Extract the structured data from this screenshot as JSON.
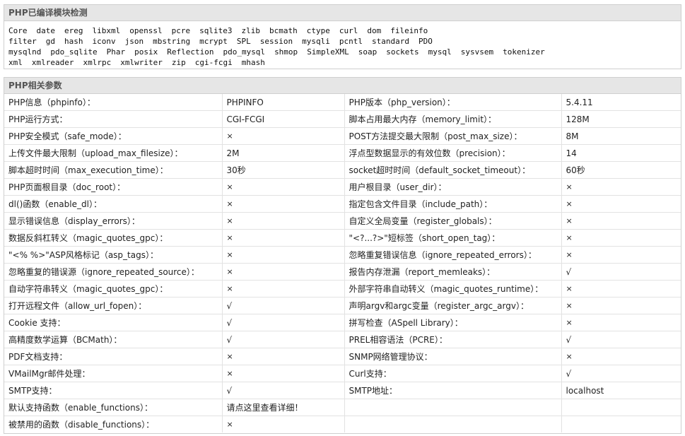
{
  "modules_panel": {
    "title": "PHP已编译模块检测",
    "lines": [
      [
        "Core",
        "date",
        "ereg",
        "libxml",
        "openssl",
        "pcre",
        "sqlite3",
        "zlib",
        "bcmath",
        "ctype",
        "curl",
        "dom",
        "fileinfo"
      ],
      [
        "filter",
        "gd",
        "hash",
        "iconv",
        "json",
        "mbstring",
        "mcrypt",
        "SPL",
        "session",
        "mysqli",
        "pcntl",
        "standard",
        "PDO"
      ],
      [
        "mysqlnd",
        "pdo_sqlite",
        "Phar",
        "posix",
        "Reflection",
        "pdo_mysql",
        "shmop",
        "SimpleXML",
        "soap",
        "sockets",
        "mysql",
        "sysvsem",
        "tokenizer"
      ],
      [
        "xml",
        "xmlreader",
        "xmlrpc",
        "xmlwriter",
        "zip",
        "cgi-fcgi",
        "mhash"
      ]
    ]
  },
  "params_panel": {
    "title": "PHP相关参数",
    "rows": [
      {
        "l1": "PHP信息（phpinfo）：",
        "v1": "PHPINFO",
        "t1": "gray",
        "l2": "PHP版本（php_version）：",
        "v2": "5.4.11",
        "t2": "text"
      },
      {
        "l1": "PHP运行方式：",
        "v1": "CGI-FCGI",
        "t1": "text",
        "l2": "脚本占用最大内存（memory_limit）：",
        "v2": "128M",
        "t2": "text"
      },
      {
        "l1": "PHP安全模式（safe_mode）：",
        "v1": "×",
        "t1": "no",
        "l2": "POST方法提交最大限制（post_max_size）：",
        "v2": "8M",
        "t2": "text"
      },
      {
        "l1": "上传文件最大限制（upload_max_filesize）：",
        "v1": "2M",
        "t1": "text",
        "l2": "浮点型数据显示的有效位数（precision）：",
        "v2": "14",
        "t2": "text"
      },
      {
        "l1": "脚本超时时间（max_execution_time）：",
        "v1": "30秒",
        "t1": "text",
        "l2": "socket超时时间（default_socket_timeout）：",
        "v2": "60秒",
        "t2": "text"
      },
      {
        "l1": "PHP页面根目录（doc_root）：",
        "v1": "×",
        "t1": "no",
        "l2": "用户根目录（user_dir）：",
        "v2": "×",
        "t2": "no"
      },
      {
        "l1": "dl()函数（enable_dl）：",
        "v1": "×",
        "t1": "no",
        "l2": "指定包含文件目录（include_path）：",
        "v2": "×",
        "t2": "no"
      },
      {
        "l1": "显示错误信息（display_errors）：",
        "v1": "×",
        "t1": "no",
        "l2": "自定义全局变量（register_globals）：",
        "v2": "×",
        "t2": "no"
      },
      {
        "l1": "数据反斜杠转义（magic_quotes_gpc）：",
        "v1": "×",
        "t1": "no",
        "l2": "\"<?...?>\"短标签（short_open_tag）：",
        "v2": "×",
        "t2": "no"
      },
      {
        "l1": "\"<% %>\"ASP风格标记（asp_tags）：",
        "v1": "×",
        "t1": "no",
        "l2": "忽略重复错误信息（ignore_repeated_errors）：",
        "v2": "×",
        "t2": "no"
      },
      {
        "l1": "忽略重复的错误源（ignore_repeated_source）：",
        "v1": "×",
        "t1": "no",
        "l2": "报告内存泄漏（report_memleaks）：",
        "v2": "√",
        "t2": "yes"
      },
      {
        "l1": "自动字符串转义（magic_quotes_gpc）：",
        "v1": "×",
        "t1": "no",
        "l2": "外部字符串自动转义（magic_quotes_runtime）：",
        "v2": "×",
        "t2": "no"
      },
      {
        "l1": "打开远程文件（allow_url_fopen）：",
        "v1": "√",
        "t1": "yes",
        "l2": "声明argv和argc变量（register_argc_argv）：",
        "v2": "×",
        "t2": "no"
      },
      {
        "l1": "Cookie 支持：",
        "v1": "√",
        "t1": "yes",
        "l2": "拼写检查（ASpell Library）：",
        "v2": "×",
        "t2": "no"
      },
      {
        "l1": "高精度数学运算（BCMath）：",
        "v1": "√",
        "t1": "yes",
        "l2": "PREL相容语法（PCRE）：",
        "v2": "√",
        "t2": "yes"
      },
      {
        "l1": "PDF文档支持：",
        "v1": "×",
        "t1": "no",
        "l2": "SNMP网络管理协议：",
        "v2": "×",
        "t2": "no"
      },
      {
        "l1": "VMailMgr邮件处理：",
        "v1": "×",
        "t1": "no",
        "l2": "Curl支持：",
        "v2": "√",
        "t2": "yes"
      },
      {
        "l1": "SMTP支持：",
        "v1": "√",
        "t1": "yes",
        "l2": "SMTP地址：",
        "v2": "localhost",
        "t2": "text"
      },
      {
        "l1": "默认支持函数（enable_functions）：",
        "v1": "请点这里查看详细！",
        "t1": "gray",
        "l2": null,
        "v2": null,
        "t2": null
      },
      {
        "l1": "被禁用的函数（disable_functions）：",
        "v1": "×",
        "t1": "no",
        "l2": null,
        "v2": null,
        "t2": null
      }
    ]
  },
  "colors": {
    "no": "#e0291f",
    "yes": "#2e9e2e",
    "header_bg": "#e6e6e6"
  }
}
